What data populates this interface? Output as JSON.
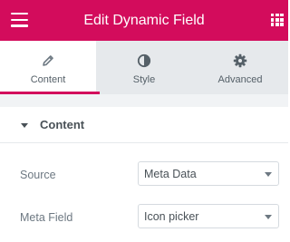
{
  "colors": {
    "accent": "#d30c5c",
    "tab_bar": "#e6e9ec",
    "panel_bg": "#f1f3f5",
    "text": "#6d7882"
  },
  "header": {
    "title": "Edit Dynamic Field",
    "left_icon": "hamburger-menu-icon",
    "right_icon": "apps-grid-icon"
  },
  "tabs": [
    {
      "label": "Content",
      "icon": "pencil-icon",
      "active": true
    },
    {
      "label": "Style",
      "icon": "half-circle-contrast-icon",
      "active": false
    },
    {
      "label": "Advanced",
      "icon": "gear-icon",
      "active": false
    }
  ],
  "section": {
    "title": "Content",
    "expanded": true
  },
  "fields": [
    {
      "label": "Source",
      "value": "Meta Data"
    },
    {
      "label": "Meta Field",
      "value": "Icon picker"
    }
  ]
}
